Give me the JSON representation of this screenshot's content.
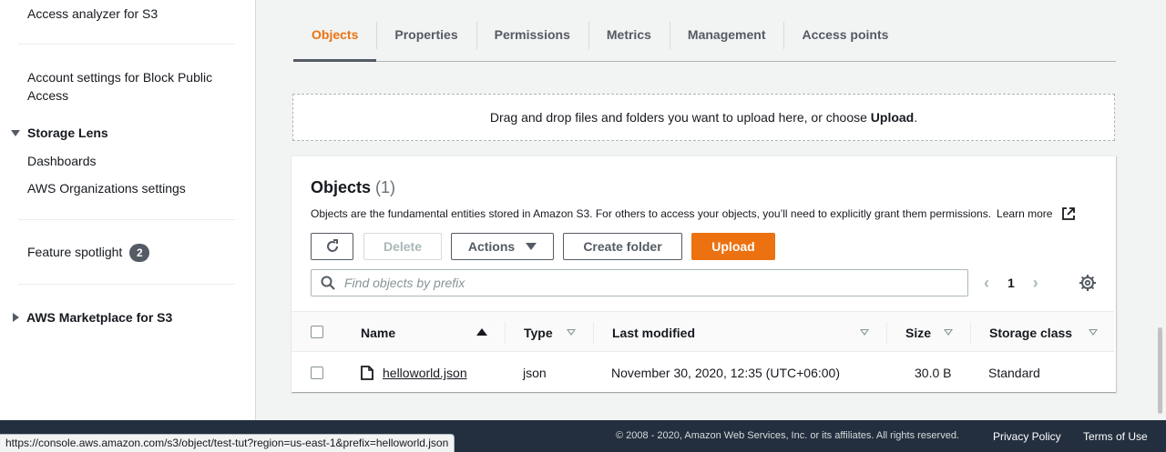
{
  "sidebar": {
    "items": [
      {
        "label": "Access analyzer for S3"
      },
      {
        "label": "Account settings for Block Public Access"
      },
      {
        "label": "Storage Lens"
      },
      {
        "label": "Dashboards"
      },
      {
        "label": "AWS Organizations settings"
      },
      {
        "label": "Feature spotlight",
        "badge": "2"
      },
      {
        "label": "AWS Marketplace for S3"
      }
    ]
  },
  "tabs": [
    "Objects",
    "Properties",
    "Permissions",
    "Metrics",
    "Management",
    "Access points"
  ],
  "dropzone": {
    "text": "Drag and drop files and folders you want to upload here, or choose ",
    "strong": "Upload",
    "end": "."
  },
  "objects": {
    "title": "Objects",
    "count": "(1)",
    "description": "Objects are the fundamental entities stored in Amazon S3. For others to access your objects, you’ll need to explicitly grant them permissions.",
    "learn_more": "Learn more",
    "buttons": {
      "delete": "Delete",
      "actions": "Actions",
      "create_folder": "Create folder",
      "upload": "Upload"
    },
    "search_placeholder": "Find objects by prefix",
    "page": "1",
    "columns": {
      "name": "Name",
      "type": "Type",
      "last_modified": "Last modified",
      "size": "Size",
      "storage_class": "Storage class"
    },
    "rows": [
      {
        "name": "helloworld.json",
        "type": "json",
        "last_modified": "November 30, 2020, 12:35 (UTC+06:00)",
        "size": "30.0 B",
        "storage_class": "Standard"
      }
    ]
  },
  "footer": {
    "copyright": "© 2008 - 2020, Amazon Web Services, Inc. or its affiliates. All rights reserved.",
    "privacy": "Privacy Policy",
    "terms": "Terms of Use"
  },
  "status_url": "https://console.aws.amazon.com/s3/object/test-tut?region=us-east-1&prefix=helloworld.json",
  "colors": {
    "accent": "#ec7211",
    "footer": "#232f3e"
  }
}
